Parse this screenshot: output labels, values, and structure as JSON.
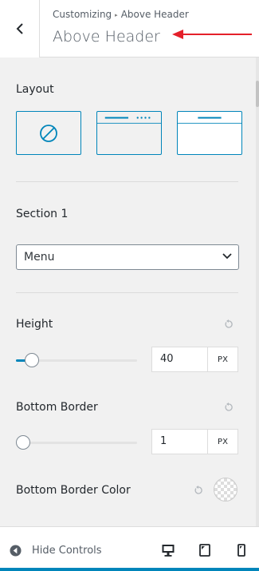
{
  "header": {
    "breadcrumb_root": "Customizing",
    "breadcrumb_sep": "▸",
    "breadcrumb_current": "Above Header",
    "title": "Above Header"
  },
  "layout": {
    "label": "Layout",
    "options": [
      "none",
      "header-with-menu",
      "header-plain"
    ],
    "selected_index": 2
  },
  "section1": {
    "label": "Section 1",
    "value": "Menu"
  },
  "height": {
    "label": "Height",
    "value": "40",
    "unit": "PX",
    "slider_fraction": 0.13
  },
  "bottom_border": {
    "label": "Bottom Border",
    "value": "1",
    "unit": "PX",
    "slider_fraction": 0.0
  },
  "bottom_border_color": {
    "label": "Bottom Border Color",
    "value": "transparent"
  },
  "footer": {
    "hide_controls": "Hide Controls",
    "devices": [
      "desktop-icon",
      "tablet-icon",
      "mobile-icon"
    ],
    "active_device": "desktop"
  },
  "colors": {
    "accent": "#0085ba",
    "annotation": "#e4202a",
    "panel_bg": "#f1f1f1"
  }
}
